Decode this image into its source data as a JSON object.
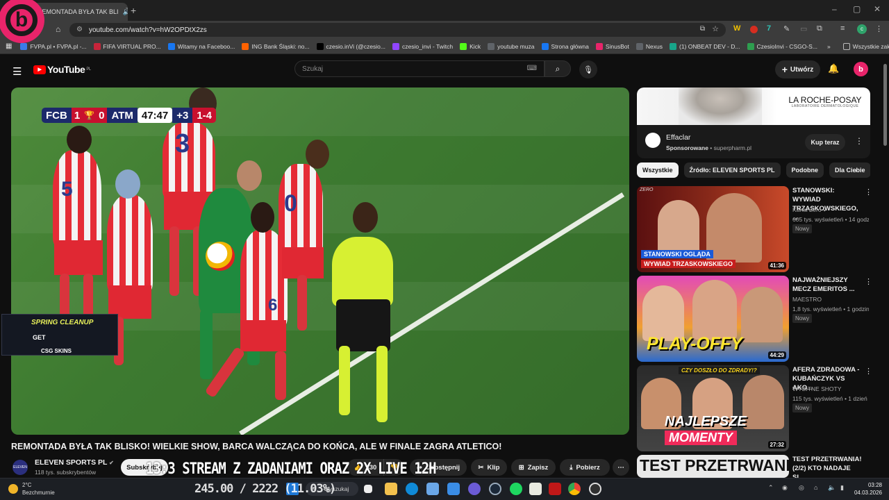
{
  "browser": {
    "tab_title": "REMONTADA BYŁA TAK BLI",
    "new_tab": "+",
    "url": "youtube.com/watch?v=hW2OPDtX2zs",
    "window_controls": [
      "–",
      "▢",
      "✕"
    ],
    "bookmarks": [
      {
        "label": "FVPA.pl • FVPA.pl -...",
        "color": "#3b7be8"
      },
      {
        "label": "FIFA VIRTUAL PRO...",
        "color": "#c7243a"
      },
      {
        "label": "Witamy na Faceboo...",
        "color": "#1877f2"
      },
      {
        "label": "ING Bank Śląski: no...",
        "color": "#ff6200"
      },
      {
        "label": "czesio.inVi (@czesio...",
        "color": "#000000"
      },
      {
        "label": "czesio_invi - Twitch",
        "color": "#9146ff"
      },
      {
        "label": "Kick",
        "color": "#53fc18"
      },
      {
        "label": "youtube muza",
        "color": "#5f6368"
      },
      {
        "label": "Strona główna",
        "color": "#1877f2"
      },
      {
        "label": "SinusBot",
        "color": "#e8246a"
      },
      {
        "label": "Nexus",
        "color": "#5f6368"
      },
      {
        "label": "(1) ONBEAT DEV - D...",
        "color": "#17a589"
      },
      {
        "label": "CzesioInvi - CSGO-S...",
        "color": "#2e9e4f"
      }
    ],
    "bookmarks_more": "»",
    "all_bookmarks": "Wszystkie zakładki",
    "profile_initial": "c"
  },
  "youtube": {
    "logo_text": "YouTube",
    "logo_country": "PL",
    "search_placeholder": "Szukaj",
    "create_label": "Utwórz",
    "avatar_initial": "b"
  },
  "video": {
    "scorebug": {
      "home": "FCB",
      "home_score": "1",
      "away_score": "0",
      "away": "ATM",
      "time": "47:47",
      "added": "+3",
      "aggregate": "1-4"
    },
    "overlay": {
      "line1": "SPRING CLEANUP",
      "line2": "GET",
      "line3": "CSG SKINS"
    },
    "title": "REMONTADA BYŁA TAK BLISKO! WIELKIE SHOW, BARCA WALCZĄCA DO KOŃCA, ALE W FINALE ZAGRA ATLETICO!",
    "channel": "ELEVEN SPORTS PL",
    "subscribers": "118 tys. subskrybentów",
    "subscribe_label": "Subskrybuj",
    "likes": "330",
    "share_label": "Udostępnij",
    "clip_label": "Klip",
    "save_label": "Zapisz",
    "download_label": "Pobierz",
    "stream_overlay": "13:3 STREAM Z ZADANIAMI ORAZ 2X LIVE 12H",
    "counter_overlay": "245.00 / 2222 (11.03%)"
  },
  "sidebar": {
    "ad": {
      "brand": "LA ROCHE-POSAY",
      "brand_sub": "LABORATOIRE DERMATOLOGIQUE",
      "title": "Effaclar",
      "sponsored": "Sponsorowane",
      "domain": "superpharm.pl",
      "cta": "Kup teraz"
    },
    "chips": [
      "Wszystkie",
      "Źródło: ELEVEN SPORTS PL",
      "Podobne",
      "Dla Ciebie"
    ],
    "videos": [
      {
        "title": "STANOWSKI: WYWIAD TRZASKOWSKIEGO, ...",
        "channel": "Kanał Zero",
        "views": "605 tys. wyświetleń • 14 godzin temu",
        "badge": "Nowy",
        "duration": "41:36",
        "thumb_text1": "STANOWSKI OGLĄDA",
        "thumb_text2": "WYWIAD TRZASKOWSKIEGO",
        "thumb_tag": "ZERO"
      },
      {
        "title": "NAJWAŻNIEJSZY MECZ EMERITOS ...",
        "channel": "MAESTRO",
        "views": "1,8 tys. wyświetleń • 1 godzinę temu",
        "badge": "Nowy",
        "duration": "44:29",
        "thumb_text1": "PLAY-OFFY"
      },
      {
        "title": "AFERA ZDRADOWA - KUBAŃCZYK VS AKO...",
        "channel": "WYBITNE SHOTY",
        "views": "115 tys. wyświetleń • 1 dzień temu",
        "badge": "Nowy",
        "duration": "27:32",
        "thumb_text1": "CZY DOSZŁO DO ZDRADY!?",
        "thumb_text2": "NAJLEPSZE",
        "thumb_text3": "MOMENTY"
      },
      {
        "title": "TEST PRZETRWANIA! (2/2) KTO NADAJE SI...",
        "thumb_text1": "TEST PRZETRWANIA"
      }
    ]
  },
  "taskbar": {
    "temperature": "2°C",
    "weather": "Bezchmurnie",
    "search_label": "Wyszukaj",
    "time": "03:28",
    "date": "04.03.2026"
  }
}
